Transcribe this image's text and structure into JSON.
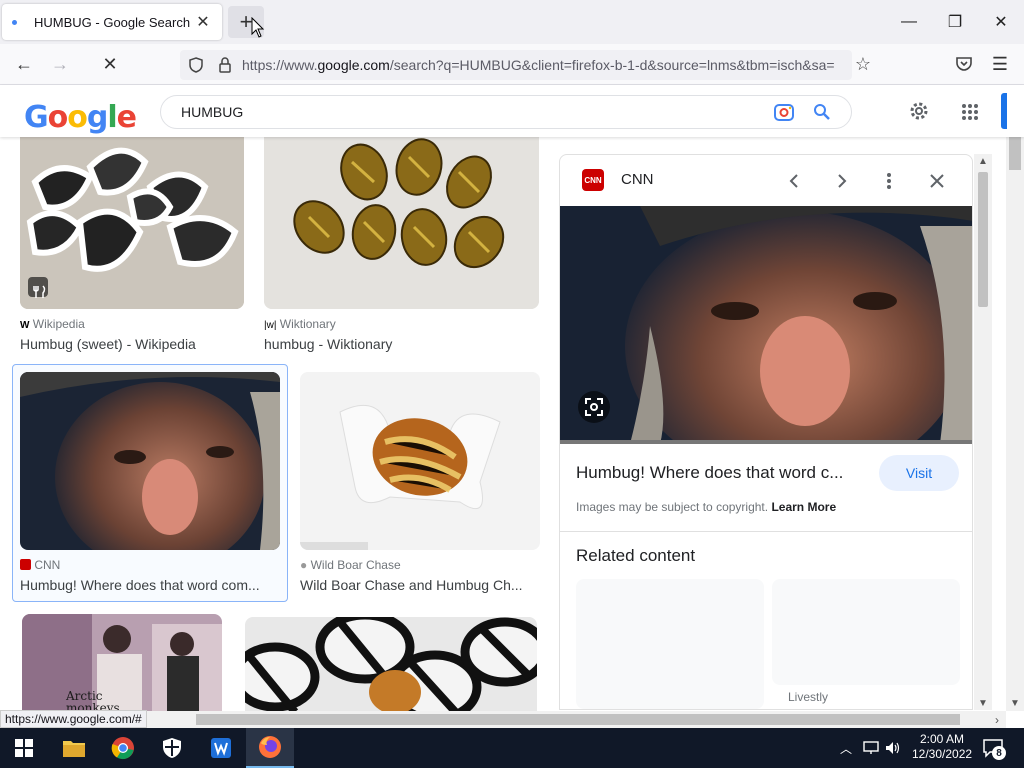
{
  "browser": {
    "tab_title": "HUMBUG - Google Search",
    "url_prefix": "https://www.",
    "url_domain": "google.com",
    "url_rest": "/search?q=HUMBUG&client=firefox-b-1-d&source=lnms&tbm=isch&sa=",
    "status_url": "https://www.google.com/#"
  },
  "google": {
    "logo_text": "Google",
    "query": "HUMBUG"
  },
  "results": [
    {
      "source": "Wikipedia",
      "title": "Humbug (sweet) - Wikipedia"
    },
    {
      "source": "Wiktionary",
      "title": "humbug - Wiktionary"
    },
    {
      "source": "CNN",
      "title": "Humbug! Where does that word com..."
    },
    {
      "source": "Wild Boar Chase",
      "title": "Wild Boar Chase and Humbug Ch..."
    }
  ],
  "album_text": "Arctic monkeys",
  "panel": {
    "source": "CNN",
    "title": "Humbug! Where does that word c...",
    "visit_label": "Visit",
    "copyright": "Images may be subject to copyright.",
    "learn_more": "Learn More",
    "related_heading": "Related content",
    "related_source": "Livestly"
  },
  "taskbar": {
    "time": "2:00 AM",
    "date": "12/30/2022",
    "notifications": "8"
  },
  "colors": {
    "accent": "#1a73e8",
    "cnn_red": "#cc0000",
    "taskbar": "#101828"
  }
}
